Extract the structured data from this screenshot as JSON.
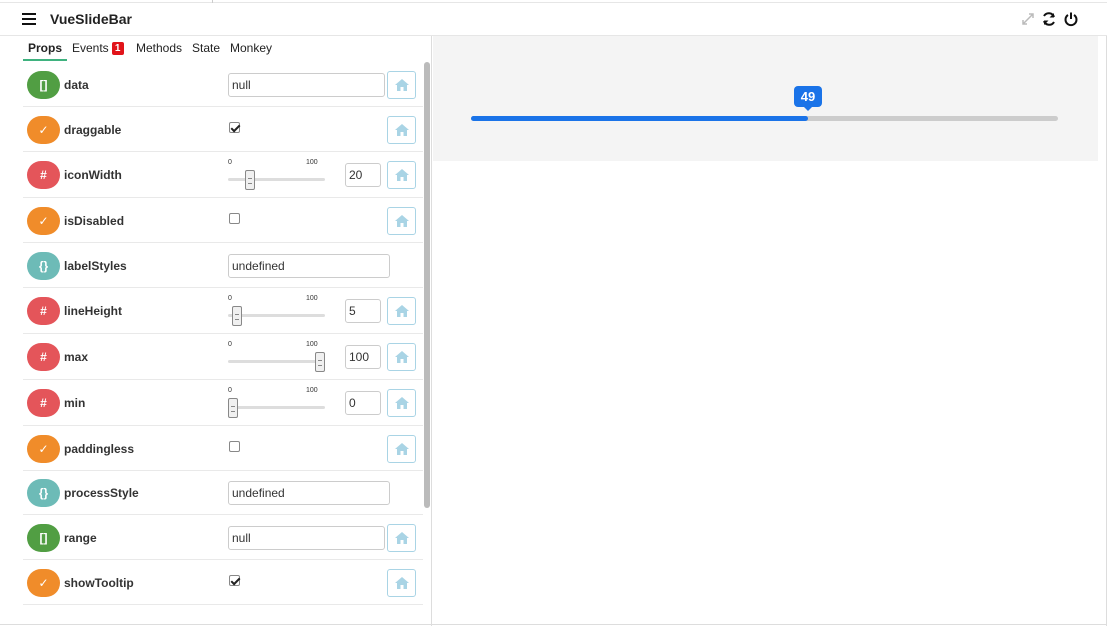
{
  "app": {
    "title": "VueSlideBar"
  },
  "icons": {
    "menu": "hamburger-menu-icon",
    "fullscreen": "expand-icon",
    "refresh": "refresh-icon",
    "power": "power-icon",
    "reset": "home-icon"
  },
  "colors": {
    "accent": "#1a73e8",
    "tab_active_underline": "#3fb27f",
    "array": "#519e43",
    "boolean": "#f08c2a",
    "number": "#e4555a",
    "object": "#6dbbb7",
    "badge": "#e1141a"
  },
  "tabs": [
    {
      "label": "Props",
      "active": true
    },
    {
      "label": "Events",
      "badge": "1"
    },
    {
      "label": "Methods"
    },
    {
      "label": "State"
    },
    {
      "label": "Monkey"
    }
  ],
  "props": [
    {
      "icon": "[]",
      "type": "array",
      "name": "data",
      "control": "text",
      "value": "null"
    },
    {
      "icon": "✓",
      "type": "boolean",
      "name": "draggable",
      "control": "checkbox",
      "checked": true
    },
    {
      "icon": "#",
      "type": "number",
      "name": "iconWidth",
      "control": "range",
      "min": "0",
      "max": "100",
      "value": "20",
      "fraction": 0.2
    },
    {
      "icon": "✓",
      "type": "boolean",
      "name": "isDisabled",
      "control": "checkbox",
      "checked": false
    },
    {
      "icon": "{}",
      "type": "object",
      "name": "labelStyles",
      "control": "text",
      "value": "undefined"
    },
    {
      "icon": "#",
      "type": "number",
      "name": "lineHeight",
      "control": "range",
      "min": "0",
      "max": "100",
      "value": "5",
      "fraction": 0.05
    },
    {
      "icon": "#",
      "type": "number",
      "name": "max",
      "control": "range",
      "min": "0",
      "max": "100",
      "value": "100",
      "fraction": 1.0
    },
    {
      "icon": "#",
      "type": "number",
      "name": "min",
      "control": "range",
      "min": "0",
      "max": "100",
      "value": "0",
      "fraction": 0.0
    },
    {
      "icon": "✓",
      "type": "boolean",
      "name": "paddingless",
      "control": "checkbox",
      "checked": false
    },
    {
      "icon": "{}",
      "type": "object",
      "name": "processStyle",
      "control": "text",
      "value": "undefined"
    },
    {
      "icon": "[]",
      "type": "array",
      "name": "range",
      "control": "text",
      "value": "null"
    },
    {
      "icon": "✓",
      "type": "boolean",
      "name": "showTooltip",
      "control": "checkbox",
      "checked": true
    }
  ],
  "preview": {
    "value": "49",
    "fraction": 0.57
  }
}
